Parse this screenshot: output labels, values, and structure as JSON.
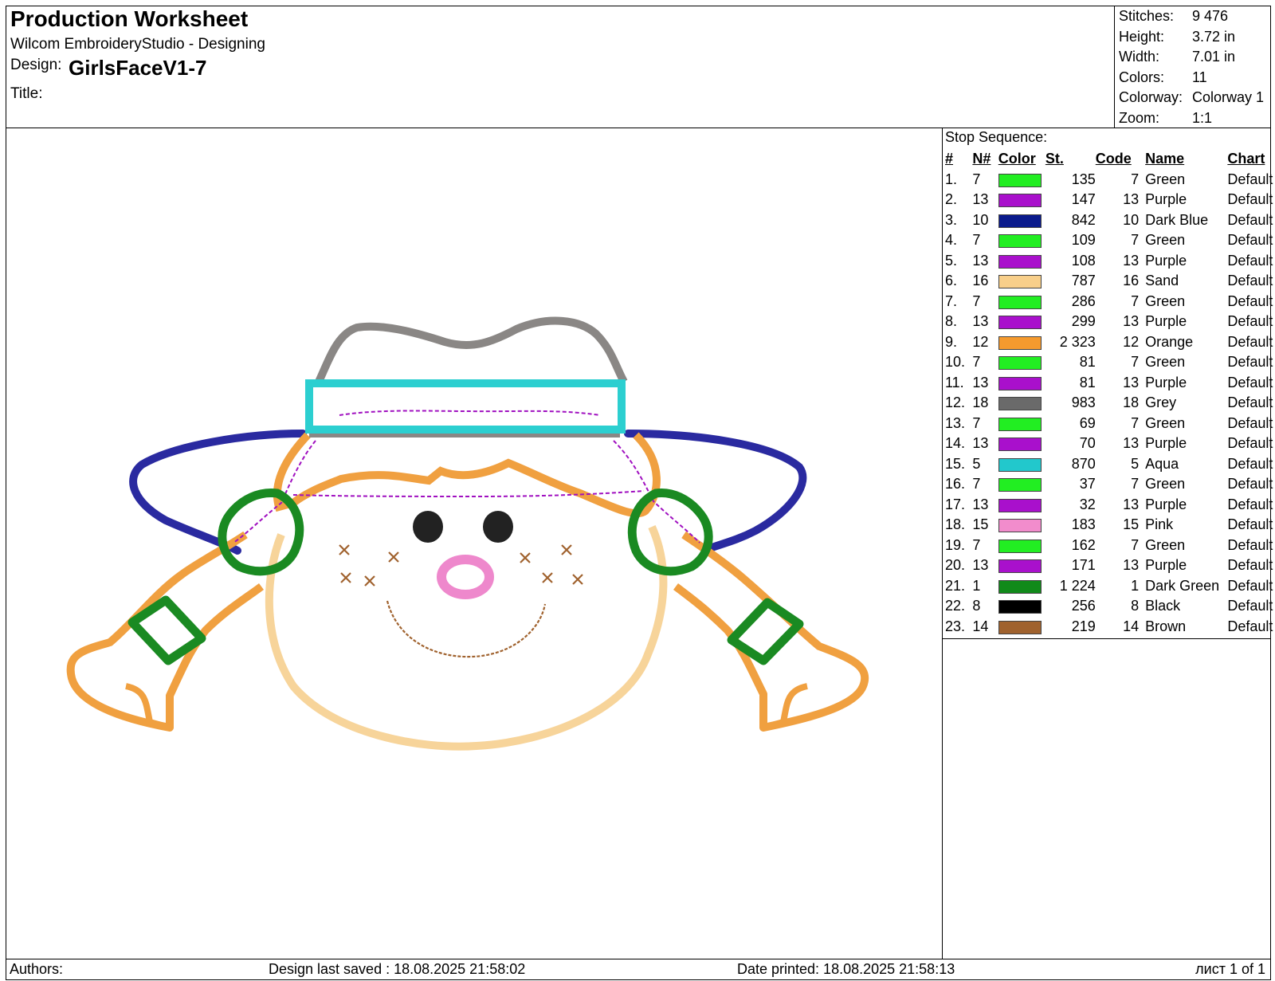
{
  "header": {
    "title": "Production Worksheet",
    "software": "Wilcom EmbroideryStudio - Designing",
    "design_label": "Design:",
    "design_name": "GirlsFaceV1-7",
    "title_label": "Title:"
  },
  "info": [
    {
      "key": "Stitches:",
      "value": "9 476"
    },
    {
      "key": "Height:",
      "value": "3.72 in"
    },
    {
      "key": "Width:",
      "value": "7.01 in"
    },
    {
      "key": "Colors:",
      "value": "11"
    },
    {
      "key": "Colorway:",
      "value": "Colorway 1"
    },
    {
      "key": "Zoom:",
      "value": "1:1"
    }
  ],
  "stop_sequence": {
    "title": "Stop Sequence:",
    "headers": {
      "idx": "#",
      "n": "N#",
      "color": "Color",
      "st": "St.",
      "code": "Code",
      "name": "Name",
      "chart": "Chart"
    },
    "rows": [
      {
        "idx": "1.",
        "n": "7",
        "color": "#22ee22",
        "st": "135",
        "code": "7",
        "name": "Green",
        "chart": "Default"
      },
      {
        "idx": "2.",
        "n": "13",
        "color": "#a910cc",
        "st": "147",
        "code": "13",
        "name": "Purple",
        "chart": "Default"
      },
      {
        "idx": "3.",
        "n": "10",
        "color": "#0a1a8c",
        "st": "842",
        "code": "10",
        "name": "Dark Blue",
        "chart": "Default"
      },
      {
        "idx": "4.",
        "n": "7",
        "color": "#22ee22",
        "st": "109",
        "code": "7",
        "name": "Green",
        "chart": "Default"
      },
      {
        "idx": "5.",
        "n": "13",
        "color": "#a910cc",
        "st": "108",
        "code": "13",
        "name": "Purple",
        "chart": "Default"
      },
      {
        "idx": "6.",
        "n": "16",
        "color": "#f8cf8a",
        "st": "787",
        "code": "16",
        "name": "Sand",
        "chart": "Default"
      },
      {
        "idx": "7.",
        "n": "7",
        "color": "#22ee22",
        "st": "286",
        "code": "7",
        "name": "Green",
        "chart": "Default"
      },
      {
        "idx": "8.",
        "n": "13",
        "color": "#a910cc",
        "st": "299",
        "code": "13",
        "name": "Purple",
        "chart": "Default"
      },
      {
        "idx": "9.",
        "n": "12",
        "color": "#f59a2e",
        "st": "2 323",
        "code": "12",
        "name": "Orange",
        "chart": "Default"
      },
      {
        "idx": "10.",
        "n": "7",
        "color": "#22ee22",
        "st": "81",
        "code": "7",
        "name": "Green",
        "chart": "Default"
      },
      {
        "idx": "11.",
        "n": "13",
        "color": "#a910cc",
        "st": "81",
        "code": "13",
        "name": "Purple",
        "chart": "Default"
      },
      {
        "idx": "12.",
        "n": "18",
        "color": "#6a6a6a",
        "st": "983",
        "code": "18",
        "name": "Grey",
        "chart": "Default"
      },
      {
        "idx": "13.",
        "n": "7",
        "color": "#22ee22",
        "st": "69",
        "code": "7",
        "name": "Green",
        "chart": "Default"
      },
      {
        "idx": "14.",
        "n": "13",
        "color": "#a910cc",
        "st": "70",
        "code": "13",
        "name": "Purple",
        "chart": "Default"
      },
      {
        "idx": "15.",
        "n": "5",
        "color": "#22c8cc",
        "st": "870",
        "code": "5",
        "name": "Aqua",
        "chart": "Default"
      },
      {
        "idx": "16.",
        "n": "7",
        "color": "#22ee22",
        "st": "37",
        "code": "7",
        "name": "Green",
        "chart": "Default"
      },
      {
        "idx": "17.",
        "n": "13",
        "color": "#a910cc",
        "st": "32",
        "code": "13",
        "name": "Purple",
        "chart": "Default"
      },
      {
        "idx": "18.",
        "n": "15",
        "color": "#f28ccc",
        "st": "183",
        "code": "15",
        "name": "Pink",
        "chart": "Default"
      },
      {
        "idx": "19.",
        "n": "7",
        "color": "#22ee22",
        "st": "162",
        "code": "7",
        "name": "Green",
        "chart": "Default"
      },
      {
        "idx": "20.",
        "n": "13",
        "color": "#a910cc",
        "st": "171",
        "code": "13",
        "name": "Purple",
        "chart": "Default"
      },
      {
        "idx": "21.",
        "n": "1",
        "color": "#118a1a",
        "st": "1 224",
        "code": "1",
        "name": "Dark Green",
        "chart": "Default"
      },
      {
        "idx": "22.",
        "n": "8",
        "color": "#000000",
        "st": "256",
        "code": "8",
        "name": "Black",
        "chart": "Default"
      },
      {
        "idx": "23.",
        "n": "14",
        "color": "#a0622e",
        "st": "219",
        "code": "14",
        "name": "Brown",
        "chart": "Default"
      }
    ]
  },
  "artwork_colors": {
    "hat_crown": "#8a8785",
    "hat_band": "#2ccfd0",
    "hat_brim": "#2a2aa0",
    "hair": "#f0a040",
    "face": "#f7d49a",
    "hair_ties": "#1a8a22",
    "purple_run": "#a010c0",
    "nose": "#ee88cc",
    "eyes": "#222222",
    "freckles": "#a0622e"
  },
  "footer": {
    "authors_label": "Authors:",
    "last_saved": "Design last saved : 18.08.2025 21:58:02",
    "date_printed": "Date printed: 18.08.2025 21:58:13",
    "page": "лист 1 of 1"
  }
}
